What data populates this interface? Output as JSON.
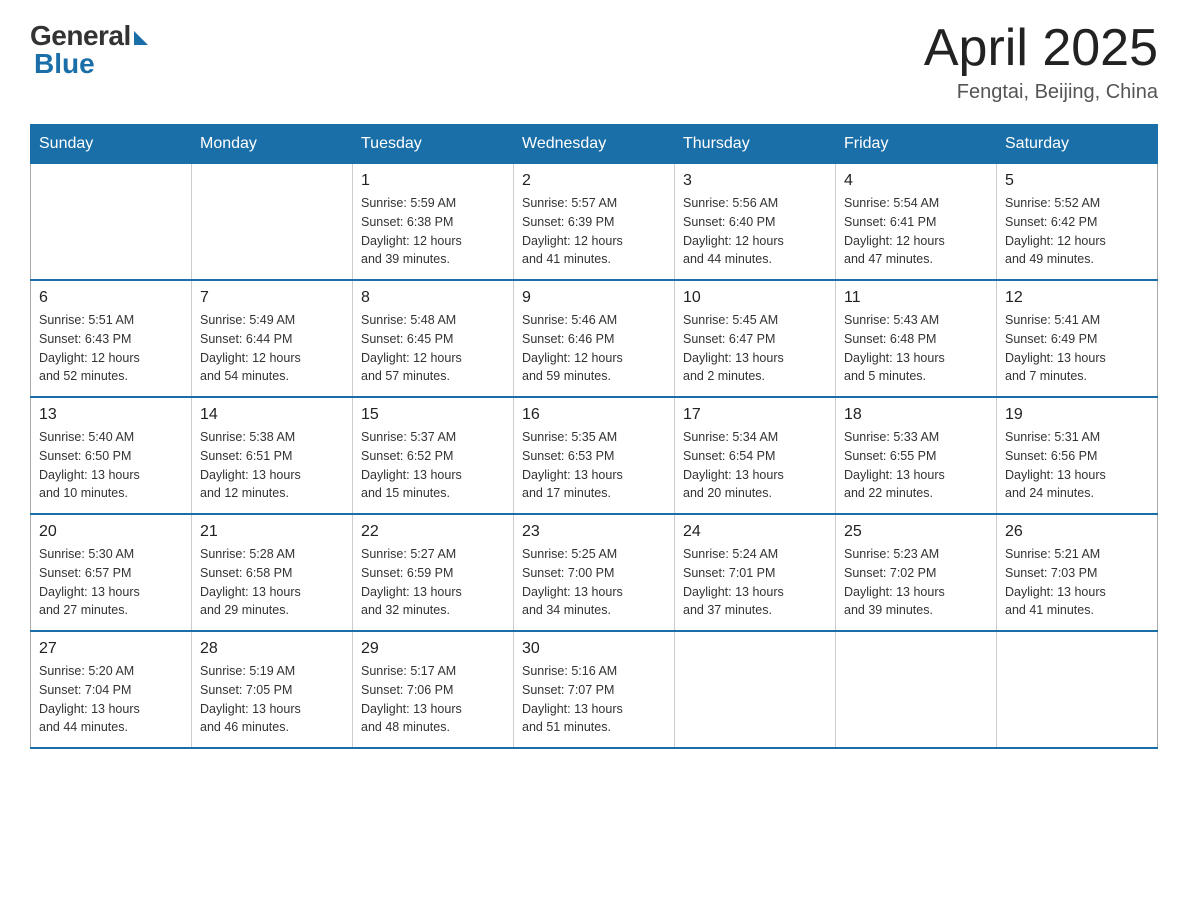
{
  "header": {
    "logo_general": "General",
    "logo_blue": "Blue",
    "month_year": "April 2025",
    "location": "Fengtai, Beijing, China"
  },
  "days_of_week": [
    "Sunday",
    "Monday",
    "Tuesday",
    "Wednesday",
    "Thursday",
    "Friday",
    "Saturday"
  ],
  "weeks": [
    [
      {
        "day": "",
        "info": ""
      },
      {
        "day": "",
        "info": ""
      },
      {
        "day": "1",
        "info": "Sunrise: 5:59 AM\nSunset: 6:38 PM\nDaylight: 12 hours\nand 39 minutes."
      },
      {
        "day": "2",
        "info": "Sunrise: 5:57 AM\nSunset: 6:39 PM\nDaylight: 12 hours\nand 41 minutes."
      },
      {
        "day": "3",
        "info": "Sunrise: 5:56 AM\nSunset: 6:40 PM\nDaylight: 12 hours\nand 44 minutes."
      },
      {
        "day": "4",
        "info": "Sunrise: 5:54 AM\nSunset: 6:41 PM\nDaylight: 12 hours\nand 47 minutes."
      },
      {
        "day": "5",
        "info": "Sunrise: 5:52 AM\nSunset: 6:42 PM\nDaylight: 12 hours\nand 49 minutes."
      }
    ],
    [
      {
        "day": "6",
        "info": "Sunrise: 5:51 AM\nSunset: 6:43 PM\nDaylight: 12 hours\nand 52 minutes."
      },
      {
        "day": "7",
        "info": "Sunrise: 5:49 AM\nSunset: 6:44 PM\nDaylight: 12 hours\nand 54 minutes."
      },
      {
        "day": "8",
        "info": "Sunrise: 5:48 AM\nSunset: 6:45 PM\nDaylight: 12 hours\nand 57 minutes."
      },
      {
        "day": "9",
        "info": "Sunrise: 5:46 AM\nSunset: 6:46 PM\nDaylight: 12 hours\nand 59 minutes."
      },
      {
        "day": "10",
        "info": "Sunrise: 5:45 AM\nSunset: 6:47 PM\nDaylight: 13 hours\nand 2 minutes."
      },
      {
        "day": "11",
        "info": "Sunrise: 5:43 AM\nSunset: 6:48 PM\nDaylight: 13 hours\nand 5 minutes."
      },
      {
        "day": "12",
        "info": "Sunrise: 5:41 AM\nSunset: 6:49 PM\nDaylight: 13 hours\nand 7 minutes."
      }
    ],
    [
      {
        "day": "13",
        "info": "Sunrise: 5:40 AM\nSunset: 6:50 PM\nDaylight: 13 hours\nand 10 minutes."
      },
      {
        "day": "14",
        "info": "Sunrise: 5:38 AM\nSunset: 6:51 PM\nDaylight: 13 hours\nand 12 minutes."
      },
      {
        "day": "15",
        "info": "Sunrise: 5:37 AM\nSunset: 6:52 PM\nDaylight: 13 hours\nand 15 minutes."
      },
      {
        "day": "16",
        "info": "Sunrise: 5:35 AM\nSunset: 6:53 PM\nDaylight: 13 hours\nand 17 minutes."
      },
      {
        "day": "17",
        "info": "Sunrise: 5:34 AM\nSunset: 6:54 PM\nDaylight: 13 hours\nand 20 minutes."
      },
      {
        "day": "18",
        "info": "Sunrise: 5:33 AM\nSunset: 6:55 PM\nDaylight: 13 hours\nand 22 minutes."
      },
      {
        "day": "19",
        "info": "Sunrise: 5:31 AM\nSunset: 6:56 PM\nDaylight: 13 hours\nand 24 minutes."
      }
    ],
    [
      {
        "day": "20",
        "info": "Sunrise: 5:30 AM\nSunset: 6:57 PM\nDaylight: 13 hours\nand 27 minutes."
      },
      {
        "day": "21",
        "info": "Sunrise: 5:28 AM\nSunset: 6:58 PM\nDaylight: 13 hours\nand 29 minutes."
      },
      {
        "day": "22",
        "info": "Sunrise: 5:27 AM\nSunset: 6:59 PM\nDaylight: 13 hours\nand 32 minutes."
      },
      {
        "day": "23",
        "info": "Sunrise: 5:25 AM\nSunset: 7:00 PM\nDaylight: 13 hours\nand 34 minutes."
      },
      {
        "day": "24",
        "info": "Sunrise: 5:24 AM\nSunset: 7:01 PM\nDaylight: 13 hours\nand 37 minutes."
      },
      {
        "day": "25",
        "info": "Sunrise: 5:23 AM\nSunset: 7:02 PM\nDaylight: 13 hours\nand 39 minutes."
      },
      {
        "day": "26",
        "info": "Sunrise: 5:21 AM\nSunset: 7:03 PM\nDaylight: 13 hours\nand 41 minutes."
      }
    ],
    [
      {
        "day": "27",
        "info": "Sunrise: 5:20 AM\nSunset: 7:04 PM\nDaylight: 13 hours\nand 44 minutes."
      },
      {
        "day": "28",
        "info": "Sunrise: 5:19 AM\nSunset: 7:05 PM\nDaylight: 13 hours\nand 46 minutes."
      },
      {
        "day": "29",
        "info": "Sunrise: 5:17 AM\nSunset: 7:06 PM\nDaylight: 13 hours\nand 48 minutes."
      },
      {
        "day": "30",
        "info": "Sunrise: 5:16 AM\nSunset: 7:07 PM\nDaylight: 13 hours\nand 51 minutes."
      },
      {
        "day": "",
        "info": ""
      },
      {
        "day": "",
        "info": ""
      },
      {
        "day": "",
        "info": ""
      }
    ]
  ]
}
